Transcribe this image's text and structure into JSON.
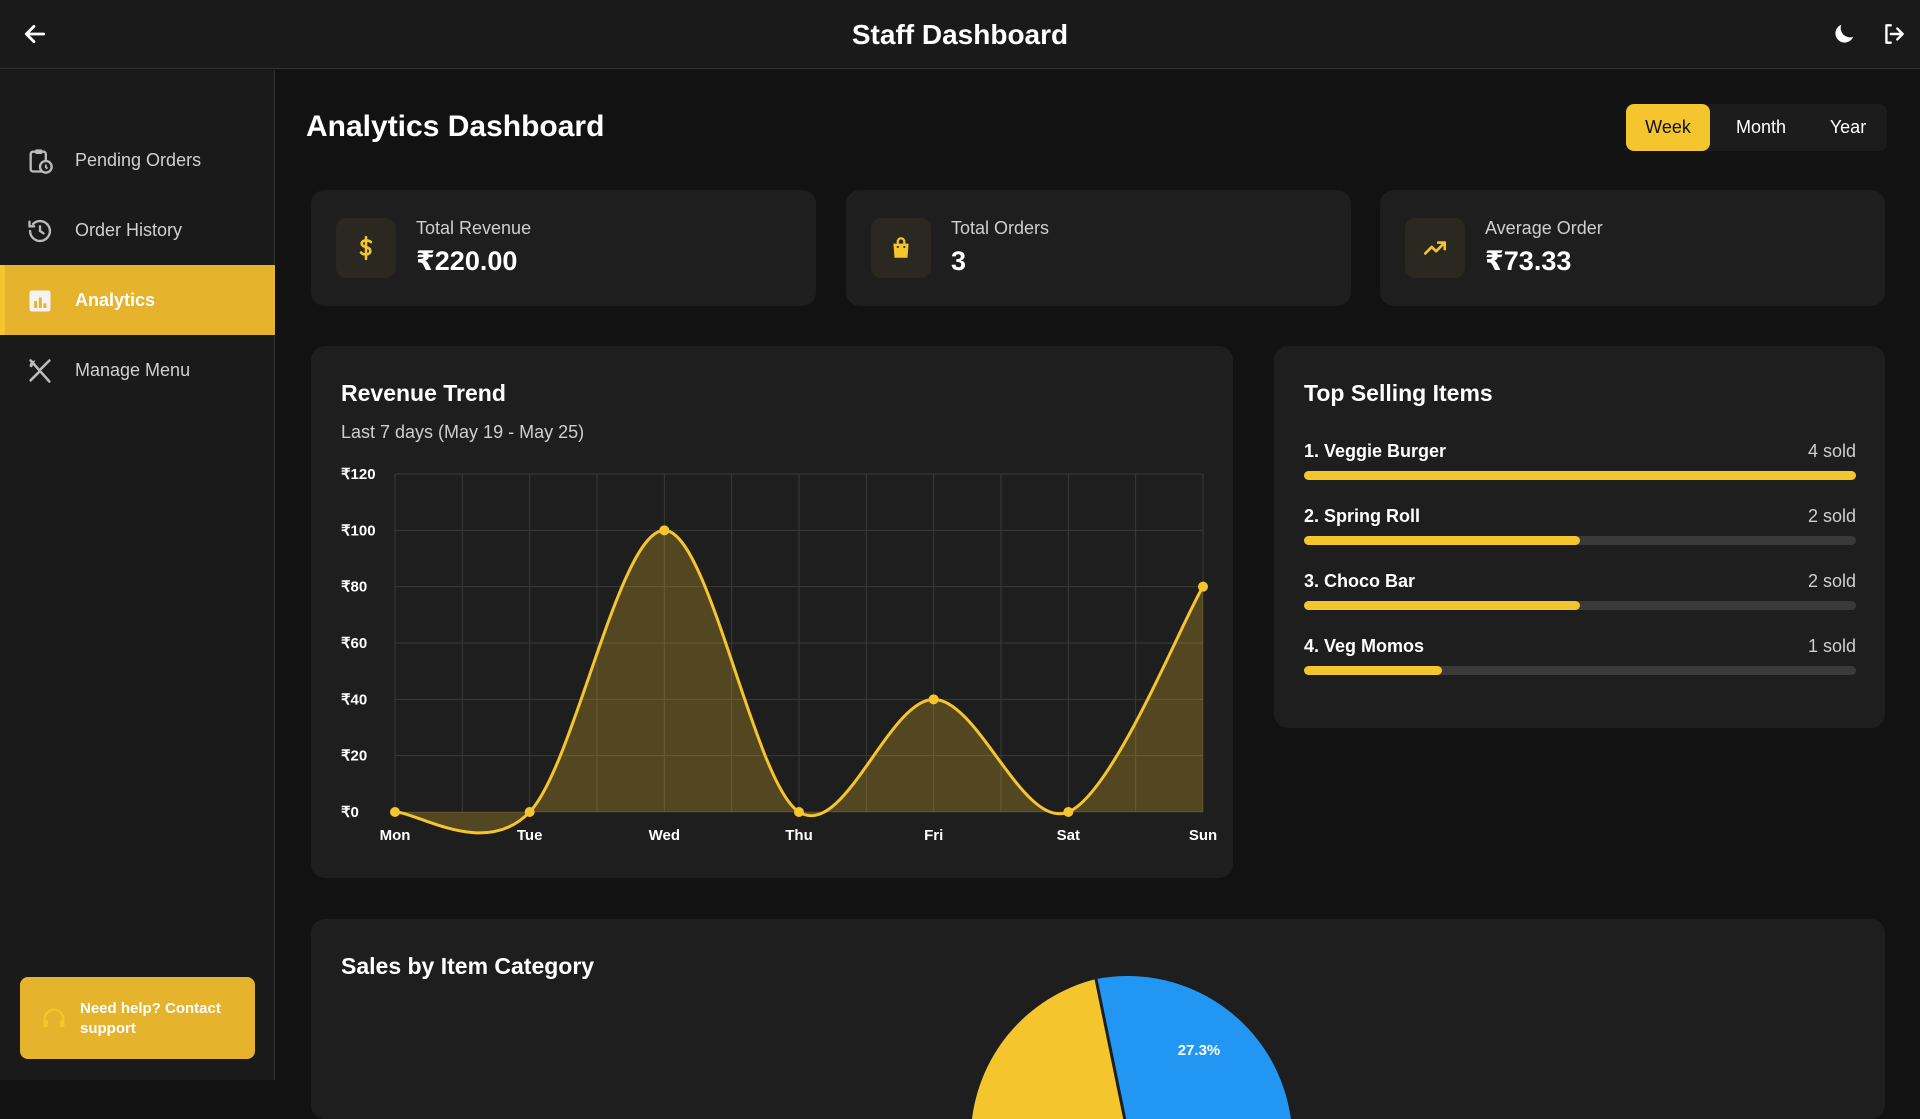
{
  "header": {
    "title": "Staff Dashboard",
    "back_icon": "arrow-left-icon",
    "theme_icon": "moon-icon",
    "logout_icon": "logout-icon"
  },
  "sidebar": {
    "items": [
      {
        "label": "Pending Orders",
        "icon": "clipboard-clock-icon",
        "active": false
      },
      {
        "label": "Order History",
        "icon": "history-icon",
        "active": false
      },
      {
        "label": "Analytics",
        "icon": "bar-chart-icon",
        "active": true
      },
      {
        "label": "Manage Menu",
        "icon": "utensils-icon",
        "active": false
      }
    ],
    "help_label": "Need help? Contact support",
    "help_icon": "headset-icon"
  },
  "main": {
    "title": "Analytics Dashboard",
    "range_tabs": [
      {
        "label": "Week",
        "active": true
      },
      {
        "label": "Month",
        "active": false
      },
      {
        "label": "Year",
        "active": false
      }
    ],
    "stats": [
      {
        "label": "Total Revenue",
        "value": "₹220.00",
        "icon": "dollar-icon"
      },
      {
        "label": "Total Orders",
        "value": "3",
        "icon": "shopping-bag-icon"
      },
      {
        "label": "Average Order",
        "value": "₹73.33",
        "icon": "trending-up-icon"
      }
    ],
    "revenue_trend": {
      "title": "Revenue Trend",
      "subtitle": "Last 7 days (May 19 - May 25)"
    },
    "top_selling": {
      "title": "Top Selling Items",
      "items": [
        {
          "name": "1. Veggie Burger",
          "count": "4 sold",
          "fraction": 1.0
        },
        {
          "name": "2. Spring Roll",
          "count": "2 sold",
          "fraction": 0.5
        },
        {
          "name": "3. Choco Bar",
          "count": "2 sold",
          "fraction": 0.5
        },
        {
          "name": "4. Veg Momos",
          "count": "1 sold",
          "fraction": 0.25
        }
      ]
    },
    "sales_by_category": {
      "title": "Sales by Item Category",
      "visible_slice_label": "27.3%"
    }
  },
  "colors": {
    "accent": "#f5c52e",
    "accent_dark": "#e6b32d",
    "pie_blue": "#2196f3",
    "background": "#121212",
    "card": "#1e1e1e"
  },
  "chart_data": [
    {
      "type": "area",
      "title": "Revenue Trend",
      "subtitle": "Last 7 days (May 19 - May 25)",
      "categories": [
        "Mon",
        "Tue",
        "Wed",
        "Thu",
        "Fri",
        "Sat",
        "Sun"
      ],
      "values": [
        0,
        0,
        100,
        0,
        40,
        0,
        80
      ],
      "y_ticks": [
        "₹0",
        "₹20",
        "₹40",
        "₹60",
        "₹80",
        "₹100",
        "₹120"
      ],
      "ylim": [
        0,
        120
      ],
      "grid": true
    },
    {
      "type": "pie",
      "title": "Sales by Item Category",
      "visible_labels": [
        "27.3%"
      ],
      "colors": [
        "#f5c52e",
        "#2196f3"
      ]
    }
  ]
}
